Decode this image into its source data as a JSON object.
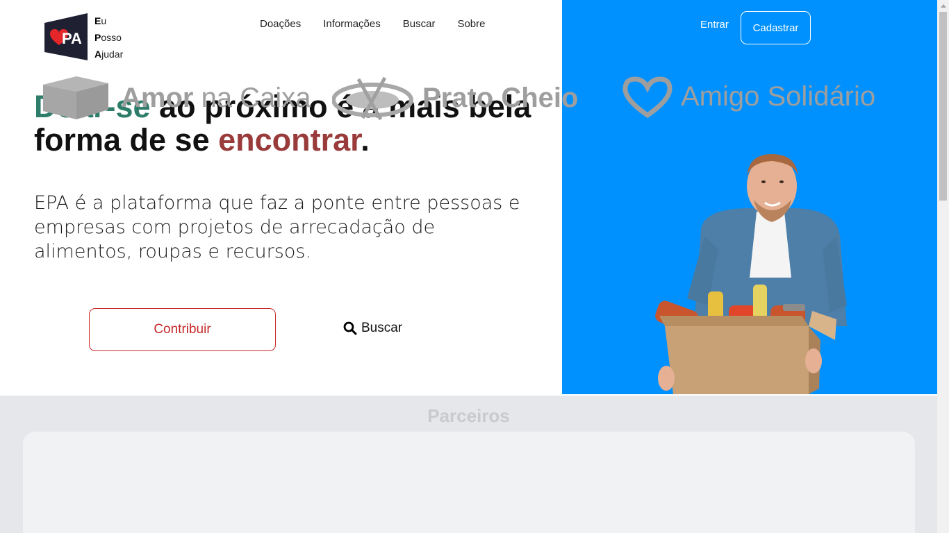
{
  "logo": {
    "mark_text": "PA",
    "line1_initial": "E",
    "line1_rest": "u",
    "line2_initial": "P",
    "line2_rest": "osso",
    "line3_initial": "A",
    "line3_rest": "judar"
  },
  "nav": {
    "items": [
      {
        "label": "Doações"
      },
      {
        "label": "Informações"
      },
      {
        "label": "Buscar"
      },
      {
        "label": "Sobre"
      }
    ]
  },
  "auth": {
    "login_label": "Entrar",
    "signup_label": "Cadastrar"
  },
  "hero": {
    "headline_part1": "Doar-se",
    "headline_part2": " ao próximo é a mais bela forma de se ",
    "headline_part3": "encontrar",
    "headline_part4": ".",
    "lead": "EPA é a plataforma que faz a ponte entre pessoas e empresas com projetos de arrecadação de alimentos, roupas e recursos.",
    "contribute_label": "Contribuir",
    "search_label": "Buscar"
  },
  "partners": {
    "title": "Parceiros",
    "items": [
      {
        "name_bold": "Amor",
        "name_rest": " na Caixa"
      },
      {
        "name": "Prato Cheio"
      },
      {
        "name": "Amigo Solidário"
      }
    ]
  },
  "colors": {
    "brand_blue": "#0091ff",
    "headline_green": "#2e7d6b",
    "headline_red": "#9a3b3b",
    "contribute_red": "#c62828",
    "partners_bg": "#e6e7eb"
  }
}
